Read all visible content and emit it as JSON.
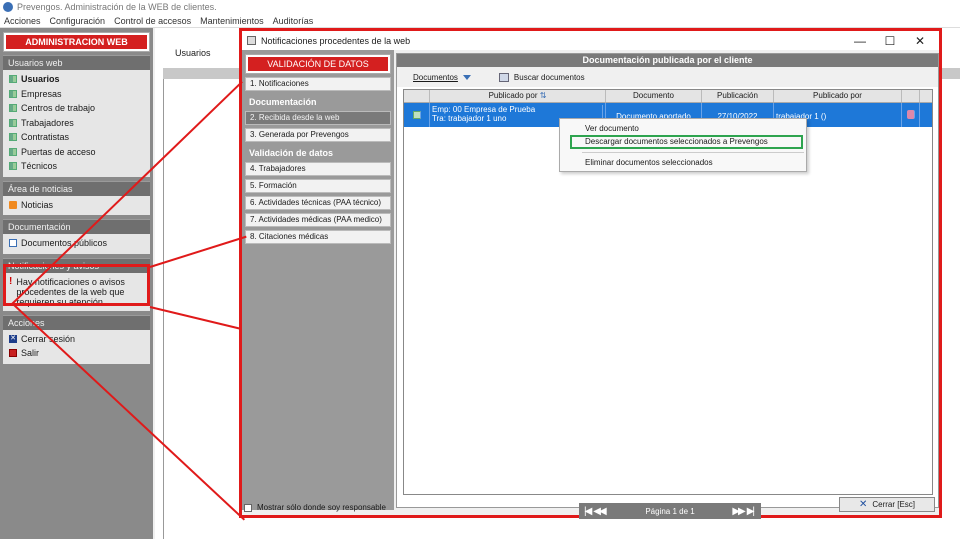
{
  "window": {
    "title": "Prevengos. Administración de la WEB de clientes."
  },
  "menubar": [
    "Acciones",
    "Configuración",
    "Control de accesos",
    "Mantenimientos",
    "Auditorías"
  ],
  "sidebar": {
    "header": "ADMINISTRACION WEB",
    "usuarios_web": {
      "title": "Usuarios web",
      "items": [
        "Usuarios",
        "Empresas",
        "Centros de trabajo",
        "Trabajadores",
        "Contratistas",
        "Puertas de acceso",
        "Técnicos"
      ]
    },
    "noticias": {
      "title": "Área de noticias",
      "items": [
        "Noticias"
      ]
    },
    "documentacion": {
      "title": "Documentación",
      "items": [
        "Documentos públicos"
      ]
    },
    "notificaciones": {
      "title": "Notificaciones y avisos",
      "text": "Hay notificaciones o avisos procedentes de la web que requieren su atención"
    },
    "acciones": {
      "title": "Acciones",
      "items": [
        "Cerrar sesión",
        "Salir"
      ]
    }
  },
  "background": {
    "toolbar_label": "Usuarios"
  },
  "dialog": {
    "title": "Notificaciones procedentes de la web",
    "controls": {
      "minimize": "—",
      "maximize": "☐",
      "close": "✕"
    },
    "left_nav": {
      "header": "VALIDACIÓN DE DATOS",
      "item_notificaciones": "1. Notificaciones",
      "section_documentacion": "Documentación",
      "item_recibida": "2. Recibida desde la web",
      "item_generada": "3. Generada por Prevengos",
      "section_validacion": "Validación de datos",
      "item_trabajadores": "4. Trabajadores",
      "item_formacion": "5. Formación",
      "item_act_tecnicas": "6. Actividades técnicas (PAA técnico)",
      "item_act_medicas": "7. Actividades médicas (PAA medico)",
      "item_citaciones": "8. Citaciones médicas"
    },
    "only_mine_label": "Mostrar sólo donde soy responsable",
    "panel": {
      "header": "Documentación publicada por el cliente",
      "toolbar": {
        "documentos": "Documentos",
        "buscar": "Buscar documentos"
      },
      "columns": [
        "Publicado por",
        "Documento",
        "Publicación",
        "Publicado por"
      ],
      "row": {
        "emp": "Emp: 00 Empresa de Prueba",
        "tra": "Tra: trabajador 1 uno",
        "documento": "Documento aportado",
        "publicacion": "27/10/2022",
        "publicado_por": "trabajador 1 ()"
      }
    },
    "context_menu": {
      "ver": "Ver documento",
      "descargar": "Descargar documentos seleccionados a Prevengos",
      "eliminar": "Eliminar documentos seleccionados"
    },
    "pager": {
      "first": "|◀",
      "prev": "◀◀",
      "text": "Página 1 de 1",
      "next": "▶▶",
      "last": "▶|"
    },
    "close_button": "Cerrar [Esc]"
  },
  "colors": {
    "highlight_red": "#e01a1a",
    "selection_blue": "#1e78d8",
    "menu_highlight_green": "#2ea44f"
  }
}
